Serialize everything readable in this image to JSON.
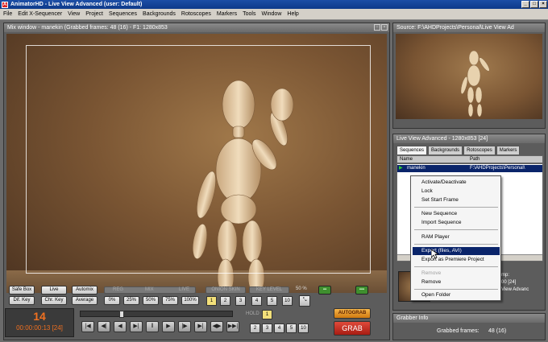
{
  "window": {
    "icon_letter": "A",
    "title": "AnimatorHD - Live View Advanced    (user: Default)"
  },
  "menu": [
    "File",
    "Edit X-Sequencer",
    "View",
    "Project",
    "Sequences",
    "Backgrounds",
    "Rotoscopes",
    "Markers",
    "Tools",
    "Window",
    "Help"
  ],
  "mix_window": {
    "title": "Mix window - manekin (Grabbed frames: 48 (16) - F1: 1280x853",
    "buttons": {
      "safe_box": "Safe Box",
      "live": "Live",
      "automix": "Automix",
      "diff_key": "Dif. Key",
      "chr_key": "Chr. Key",
      "average": "Average",
      "z0": "0%",
      "z25": "25%",
      "z50": "50%",
      "z75": "75%",
      "z100": "100%"
    },
    "slider_labels": {
      "reg": "REG",
      "mix": "MIX",
      "live": "LIVE",
      "onion_skin": "ONION SKIN",
      "kz": "KEY LEVEL"
    },
    "percent": "50 %",
    "step_buttons": [
      "1",
      "2",
      "3",
      "4",
      "5",
      "10"
    ],
    "hold_label": "HOLD",
    "hold_value": "1",
    "hold_buttons": [
      "2",
      "3",
      "4",
      "5",
      "10"
    ],
    "autograb": "AUTOGRAB",
    "grab": "GRAB",
    "frame_number": "14",
    "timecode": "00:00:00:13 [24]",
    "transport": [
      "|◀",
      "◀|",
      "◀",
      "▶|",
      "‖",
      "▶",
      "|▶",
      "▶|",
      "◀▶",
      "▶▶|"
    ]
  },
  "source": {
    "title": "Source: F:\\AHDProjects\\Personal\\Live View Ad"
  },
  "live_view": {
    "title": "Live View Advanced - 1280x853 [24]",
    "tabs": [
      "Sequences",
      "Backgrounds",
      "Rotoscopes",
      "Markers"
    ],
    "columns": [
      "Name",
      "Path"
    ],
    "row": {
      "name": "manekin",
      "path": "F:\\AHDProjects\\Personal\\"
    },
    "partial_text": {
      "a": "mp:",
      "b": "00 [24]",
      "c": "View Advanc"
    }
  },
  "context_menu": {
    "items": [
      {
        "label": "Activate/Deactivate",
        "enabled": true
      },
      {
        "label": "Lock",
        "enabled": true
      },
      {
        "label": "Set Start Frame",
        "enabled": true
      },
      {
        "label": "New Sequence",
        "enabled": true
      },
      {
        "label": "Import Sequence",
        "enabled": true
      },
      {
        "label": "RAM Player",
        "enabled": true
      },
      {
        "label": "Export (files, AVI)",
        "enabled": true,
        "highlighted": true
      },
      {
        "label": "Export as Premiere Project",
        "enabled": true
      },
      {
        "label": "Remove",
        "enabled": false
      },
      {
        "label": "Remove",
        "enabled": true
      },
      {
        "label": "Open Folder",
        "enabled": true
      }
    ]
  },
  "grabber": {
    "title": "Grabber Info",
    "label": "Grabbed frames:",
    "value": "48 (16)"
  }
}
